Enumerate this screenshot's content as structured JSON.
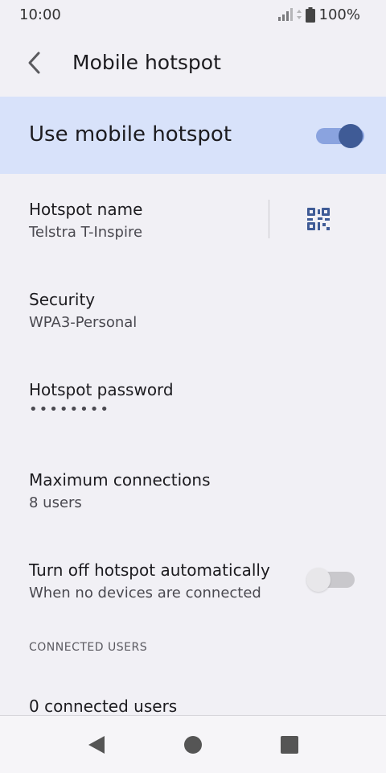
{
  "status_bar": {
    "time": "10:00",
    "battery_percent": "100%",
    "icons": [
      "signal-icon",
      "battery-icon"
    ]
  },
  "toolbar": {
    "title": "Mobile hotspot",
    "back_icon": "back-arrow-icon"
  },
  "master_switch": {
    "label": "Use mobile hotspot",
    "checked": true
  },
  "prefs": {
    "hotspot_name": {
      "title": "Hotspot name",
      "summary": "Telstra T-Inspire",
      "action_icon": "qr-code-icon"
    },
    "security": {
      "title": "Security",
      "summary": "WPA3-Personal"
    },
    "password": {
      "title": "Hotspot password",
      "summary": "••••••••"
    },
    "max_connections": {
      "title": "Maximum connections",
      "summary": "8 users"
    },
    "auto_off": {
      "title": "Turn off hotspot automatically",
      "summary": "When no devices are connected",
      "checked": false
    }
  },
  "connected_users": {
    "header": "CONNECTED USERS",
    "count_label": "0 connected users"
  },
  "nav_bar": {
    "icons": [
      "back-triangle-icon",
      "home-circle-icon",
      "recents-square-icon"
    ]
  },
  "colors": {
    "accent": "#3f5b96",
    "accent_track": "#8aa3df",
    "highlight_bg": "#d8e2fa",
    "background": "#f1f0f5"
  }
}
